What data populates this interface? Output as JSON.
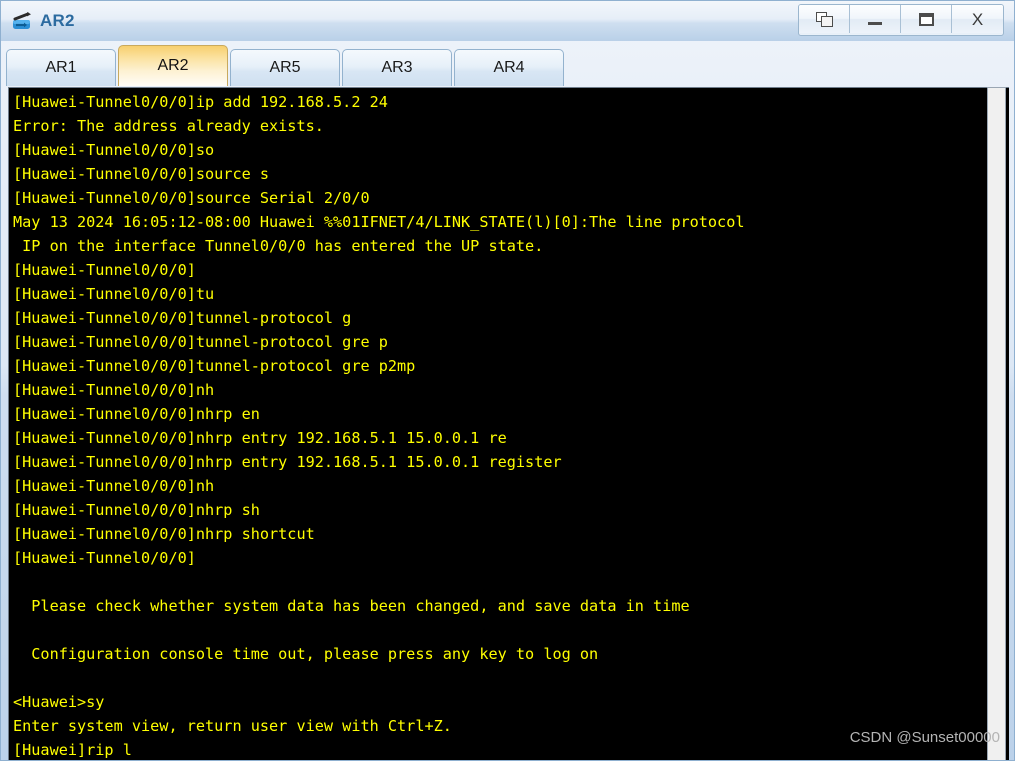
{
  "window": {
    "title": "AR2",
    "app_icon": "router-icon",
    "controls": [
      {
        "name": "cascade-windows-button",
        "icon": "cascade-windows-icon",
        "label": ""
      },
      {
        "name": "minimize-button",
        "icon": "minimize-icon",
        "label": ""
      },
      {
        "name": "maximize-button",
        "icon": "maximize-icon",
        "label": ""
      },
      {
        "name": "close-button",
        "icon": "close-icon",
        "label": "X"
      }
    ]
  },
  "tabs": [
    {
      "label": "AR1",
      "active": false
    },
    {
      "label": "AR2",
      "active": true
    },
    {
      "label": "AR5",
      "active": false
    },
    {
      "label": "AR3",
      "active": false
    },
    {
      "label": "AR4",
      "active": false
    }
  ],
  "terminal": {
    "text_color": "#ffff00",
    "background_color": "#000000",
    "lines": [
      "[Huawei-Tunnel0/0/0]ip add 192.168.5.2 24",
      "Error: The address already exists.",
      "[Huawei-Tunnel0/0/0]so",
      "[Huawei-Tunnel0/0/0]source s",
      "[Huawei-Tunnel0/0/0]source Serial 2/0/0",
      "May 13 2024 16:05:12-08:00 Huawei %%01IFNET/4/LINK_STATE(l)[0]:The line protocol",
      " IP on the interface Tunnel0/0/0 has entered the UP state.",
      "[Huawei-Tunnel0/0/0]",
      "[Huawei-Tunnel0/0/0]tu",
      "[Huawei-Tunnel0/0/0]tunnel-protocol g",
      "[Huawei-Tunnel0/0/0]tunnel-protocol gre p",
      "[Huawei-Tunnel0/0/0]tunnel-protocol gre p2mp",
      "[Huawei-Tunnel0/0/0]nh",
      "[Huawei-Tunnel0/0/0]nhrp en",
      "[Huawei-Tunnel0/0/0]nhrp entry 192.168.5.1 15.0.0.1 re",
      "[Huawei-Tunnel0/0/0]nhrp entry 192.168.5.1 15.0.0.1 register",
      "[Huawei-Tunnel0/0/0]nh",
      "[Huawei-Tunnel0/0/0]nhrp sh",
      "[Huawei-Tunnel0/0/0]nhrp shortcut",
      "[Huawei-Tunnel0/0/0]",
      "",
      "  Please check whether system data has been changed, and save data in time",
      "",
      "  Configuration console time out, please press any key to log on",
      "",
      "<Huawei>sy",
      "Enter system view, return user view with Ctrl+Z.",
      "[Huawei]rip l"
    ]
  },
  "watermark": {
    "text": "CSDN @Sunset00000"
  }
}
